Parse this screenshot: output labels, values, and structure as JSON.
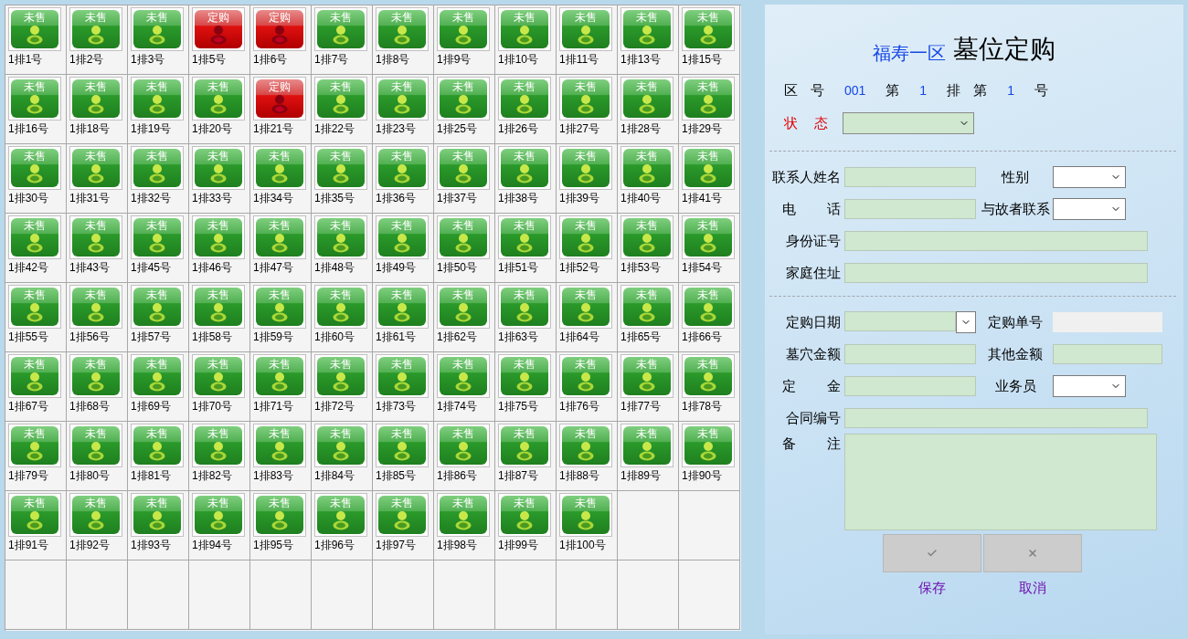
{
  "slots": [
    {
      "label": "1排1号",
      "status": "未售",
      "kind": "unsold"
    },
    {
      "label": "1排2号",
      "status": "未售",
      "kind": "unsold"
    },
    {
      "label": "1排3号",
      "status": "未售",
      "kind": "unsold"
    },
    {
      "label": "1排5号",
      "status": "定购",
      "kind": "reserved"
    },
    {
      "label": "1排6号",
      "status": "定购",
      "kind": "reserved"
    },
    {
      "label": "1排7号",
      "status": "未售",
      "kind": "unsold"
    },
    {
      "label": "1排8号",
      "status": "未售",
      "kind": "unsold"
    },
    {
      "label": "1排9号",
      "status": "未售",
      "kind": "unsold"
    },
    {
      "label": "1排10号",
      "status": "未售",
      "kind": "unsold"
    },
    {
      "label": "1排11号",
      "status": "未售",
      "kind": "unsold"
    },
    {
      "label": "1排13号",
      "status": "未售",
      "kind": "unsold"
    },
    {
      "label": "1排15号",
      "status": "未售",
      "kind": "unsold"
    },
    {
      "label": "1排16号",
      "status": "未售",
      "kind": "unsold"
    },
    {
      "label": "1排18号",
      "status": "未售",
      "kind": "unsold"
    },
    {
      "label": "1排19号",
      "status": "未售",
      "kind": "unsold"
    },
    {
      "label": "1排20号",
      "status": "未售",
      "kind": "unsold"
    },
    {
      "label": "1排21号",
      "status": "定购",
      "kind": "reserved"
    },
    {
      "label": "1排22号",
      "status": "未售",
      "kind": "unsold"
    },
    {
      "label": "1排23号",
      "status": "未售",
      "kind": "unsold"
    },
    {
      "label": "1排25号",
      "status": "未售",
      "kind": "unsold"
    },
    {
      "label": "1排26号",
      "status": "未售",
      "kind": "unsold"
    },
    {
      "label": "1排27号",
      "status": "未售",
      "kind": "unsold"
    },
    {
      "label": "1排28号",
      "status": "未售",
      "kind": "unsold"
    },
    {
      "label": "1排29号",
      "status": "未售",
      "kind": "unsold"
    },
    {
      "label": "1排30号",
      "status": "未售",
      "kind": "unsold"
    },
    {
      "label": "1排31号",
      "status": "未售",
      "kind": "unsold"
    },
    {
      "label": "1排32号",
      "status": "未售",
      "kind": "unsold"
    },
    {
      "label": "1排33号",
      "status": "未售",
      "kind": "unsold"
    },
    {
      "label": "1排34号",
      "status": "未售",
      "kind": "unsold"
    },
    {
      "label": "1排35号",
      "status": "未售",
      "kind": "unsold"
    },
    {
      "label": "1排36号",
      "status": "未售",
      "kind": "unsold"
    },
    {
      "label": "1排37号",
      "status": "未售",
      "kind": "unsold"
    },
    {
      "label": "1排38号",
      "status": "未售",
      "kind": "unsold"
    },
    {
      "label": "1排39号",
      "status": "未售",
      "kind": "unsold"
    },
    {
      "label": "1排40号",
      "status": "未售",
      "kind": "unsold"
    },
    {
      "label": "1排41号",
      "status": "未售",
      "kind": "unsold"
    },
    {
      "label": "1排42号",
      "status": "未售",
      "kind": "unsold"
    },
    {
      "label": "1排43号",
      "status": "未售",
      "kind": "unsold"
    },
    {
      "label": "1排45号",
      "status": "未售",
      "kind": "unsold"
    },
    {
      "label": "1排46号",
      "status": "未售",
      "kind": "unsold"
    },
    {
      "label": "1排47号",
      "status": "未售",
      "kind": "unsold"
    },
    {
      "label": "1排48号",
      "status": "未售",
      "kind": "unsold"
    },
    {
      "label": "1排49号",
      "status": "未售",
      "kind": "unsold"
    },
    {
      "label": "1排50号",
      "status": "未售",
      "kind": "unsold"
    },
    {
      "label": "1排51号",
      "status": "未售",
      "kind": "unsold"
    },
    {
      "label": "1排52号",
      "status": "未售",
      "kind": "unsold"
    },
    {
      "label": "1排53号",
      "status": "未售",
      "kind": "unsold"
    },
    {
      "label": "1排54号",
      "status": "未售",
      "kind": "unsold"
    },
    {
      "label": "1排55号",
      "status": "未售",
      "kind": "unsold"
    },
    {
      "label": "1排56号",
      "status": "未售",
      "kind": "unsold"
    },
    {
      "label": "1排57号",
      "status": "未售",
      "kind": "unsold"
    },
    {
      "label": "1排58号",
      "status": "未售",
      "kind": "unsold"
    },
    {
      "label": "1排59号",
      "status": "未售",
      "kind": "unsold"
    },
    {
      "label": "1排60号",
      "status": "未售",
      "kind": "unsold"
    },
    {
      "label": "1排61号",
      "status": "未售",
      "kind": "unsold"
    },
    {
      "label": "1排62号",
      "status": "未售",
      "kind": "unsold"
    },
    {
      "label": "1排63号",
      "status": "未售",
      "kind": "unsold"
    },
    {
      "label": "1排64号",
      "status": "未售",
      "kind": "unsold"
    },
    {
      "label": "1排65号",
      "status": "未售",
      "kind": "unsold"
    },
    {
      "label": "1排66号",
      "status": "未售",
      "kind": "unsold"
    },
    {
      "label": "1排67号",
      "status": "未售",
      "kind": "unsold"
    },
    {
      "label": "1排68号",
      "status": "未售",
      "kind": "unsold"
    },
    {
      "label": "1排69号",
      "status": "未售",
      "kind": "unsold"
    },
    {
      "label": "1排70号",
      "status": "未售",
      "kind": "unsold"
    },
    {
      "label": "1排71号",
      "status": "未售",
      "kind": "unsold"
    },
    {
      "label": "1排72号",
      "status": "未售",
      "kind": "unsold"
    },
    {
      "label": "1排73号",
      "status": "未售",
      "kind": "unsold"
    },
    {
      "label": "1排74号",
      "status": "未售",
      "kind": "unsold"
    },
    {
      "label": "1排75号",
      "status": "未售",
      "kind": "unsold"
    },
    {
      "label": "1排76号",
      "status": "未售",
      "kind": "unsold"
    },
    {
      "label": "1排77号",
      "status": "未售",
      "kind": "unsold"
    },
    {
      "label": "1排78号",
      "status": "未售",
      "kind": "unsold"
    },
    {
      "label": "1排79号",
      "status": "未售",
      "kind": "unsold"
    },
    {
      "label": "1排80号",
      "status": "未售",
      "kind": "unsold"
    },
    {
      "label": "1排81号",
      "status": "未售",
      "kind": "unsold"
    },
    {
      "label": "1排82号",
      "status": "未售",
      "kind": "unsold"
    },
    {
      "label": "1排83号",
      "status": "未售",
      "kind": "unsold"
    },
    {
      "label": "1排84号",
      "status": "未售",
      "kind": "unsold"
    },
    {
      "label": "1排85号",
      "status": "未售",
      "kind": "unsold"
    },
    {
      "label": "1排86号",
      "status": "未售",
      "kind": "unsold"
    },
    {
      "label": "1排87号",
      "status": "未售",
      "kind": "unsold"
    },
    {
      "label": "1排88号",
      "status": "未售",
      "kind": "unsold"
    },
    {
      "label": "1排89号",
      "status": "未售",
      "kind": "unsold"
    },
    {
      "label": "1排90号",
      "status": "未售",
      "kind": "unsold"
    },
    {
      "label": "1排91号",
      "status": "未售",
      "kind": "unsold"
    },
    {
      "label": "1排92号",
      "status": "未售",
      "kind": "unsold"
    },
    {
      "label": "1排93号",
      "status": "未售",
      "kind": "unsold"
    },
    {
      "label": "1排94号",
      "status": "未售",
      "kind": "unsold"
    },
    {
      "label": "1排95号",
      "status": "未售",
      "kind": "unsold"
    },
    {
      "label": "1排96号",
      "status": "未售",
      "kind": "unsold"
    },
    {
      "label": "1排97号",
      "status": "未售",
      "kind": "unsold"
    },
    {
      "label": "1排98号",
      "status": "未售",
      "kind": "unsold"
    },
    {
      "label": "1排99号",
      "status": "未售",
      "kind": "unsold"
    },
    {
      "label": "1排100号",
      "status": "未售",
      "kind": "unsold"
    }
  ],
  "form": {
    "zone": "福寿一区",
    "title": "墓位定购",
    "position": [
      {
        "kind": "label",
        "text": "区 号"
      },
      {
        "kind": "value",
        "text": "001"
      },
      {
        "kind": "label",
        "text": "第"
      },
      {
        "kind": "value",
        "text": "1"
      },
      {
        "kind": "label",
        "text": "排 第"
      },
      {
        "kind": "value",
        "text": "1"
      },
      {
        "kind": "label",
        "text": "号"
      }
    ],
    "status": {
      "label": "状 态"
    },
    "section_1": [
      [
        {
          "label": "联系人姓名",
          "kind": "text"
        },
        {
          "label": "性别",
          "kind": "select"
        }
      ],
      [
        {
          "label": "电 话",
          "kind": "text"
        },
        {
          "label": "与故者联系",
          "kind": "select"
        }
      ],
      [
        {
          "label": "身份证号",
          "kind": "text"
        }
      ],
      [
        {
          "label": "家庭住址",
          "kind": "text"
        }
      ]
    ],
    "section_2": [
      [
        {
          "label": "定购日期",
          "kind": "date"
        },
        {
          "label": "定购单号",
          "kind": "readonly"
        }
      ],
      [
        {
          "label": "墓穴金额",
          "kind": "text"
        },
        {
          "label": "其他金额",
          "kind": "text"
        }
      ],
      [
        {
          "label": "定 金",
          "kind": "text"
        },
        {
          "label": "业务员",
          "kind": "select"
        }
      ],
      [
        {
          "label": "合同编号",
          "kind": "text"
        }
      ],
      [
        {
          "label": "备 注",
          "kind": "textarea"
        }
      ]
    ],
    "buttons": [
      {
        "kind": "save",
        "label": "保存"
      },
      {
        "kind": "cancel",
        "label": "取消"
      }
    ]
  }
}
